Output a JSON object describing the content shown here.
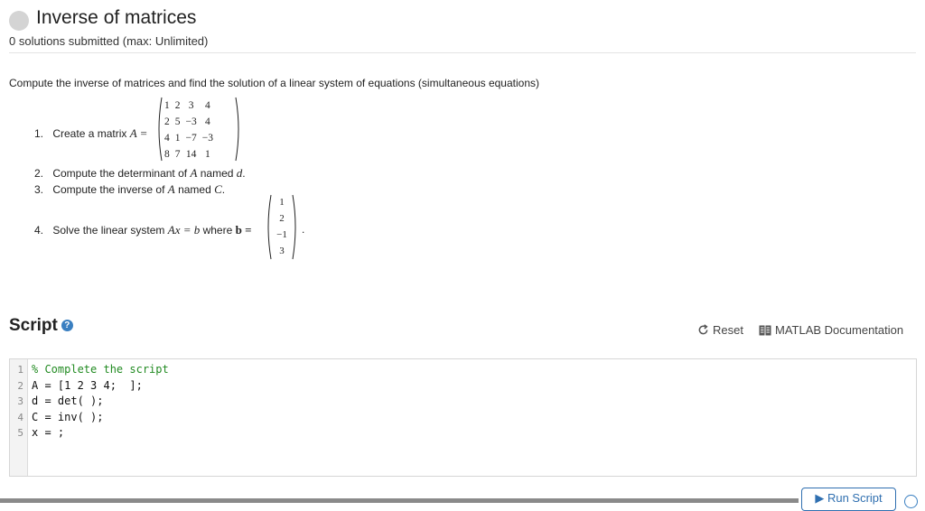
{
  "header": {
    "title": "Inverse of matrices",
    "submission_status": "0 solutions submitted (max: Unlimited)"
  },
  "problem": {
    "intro": "Compute the inverse of matrices and find the solution of a linear system of equations (simultaneous equations)",
    "steps": [
      {
        "num": "1.",
        "text": "Create a matrix",
        "math": "A =",
        "after": ""
      },
      {
        "num": "2.",
        "text": "Compute the determinant of",
        "math": "A",
        "after": "named",
        "var": "d",
        "end": "."
      },
      {
        "num": "3.",
        "text": "Compute the inverse of",
        "math": "A",
        "after": "named",
        "var": "C",
        "end": "."
      },
      {
        "num": "4.",
        "text": "Solve the linear system",
        "math": "Ax = b",
        "after": "where",
        "var": "b =",
        "end": "."
      }
    ],
    "matrix_A": [
      [
        "1",
        "2",
        "3",
        "4"
      ],
      [
        "2",
        "5",
        "−3",
        "4"
      ],
      [
        "4",
        "1",
        "−7",
        "−3"
      ],
      [
        "8",
        "7",
        "14",
        "1"
      ]
    ],
    "vector_b": [
      "1",
      "2",
      "−1",
      "3"
    ]
  },
  "script": {
    "label": "Script",
    "reset_label": "Reset",
    "doc_label": "MATLAB Documentation",
    "lines": [
      "% Complete the script",
      "A = [1 2 3 4;  ];",
      "d = det( );",
      "C = inv( );",
      "x = ;"
    ],
    "line_numbers": [
      "1",
      "2",
      "3",
      "4",
      "5"
    ]
  },
  "actions": {
    "run_label": "▶ Run Script"
  },
  "colors": {
    "accent": "#2f6fb0",
    "comment": "#228b22"
  }
}
